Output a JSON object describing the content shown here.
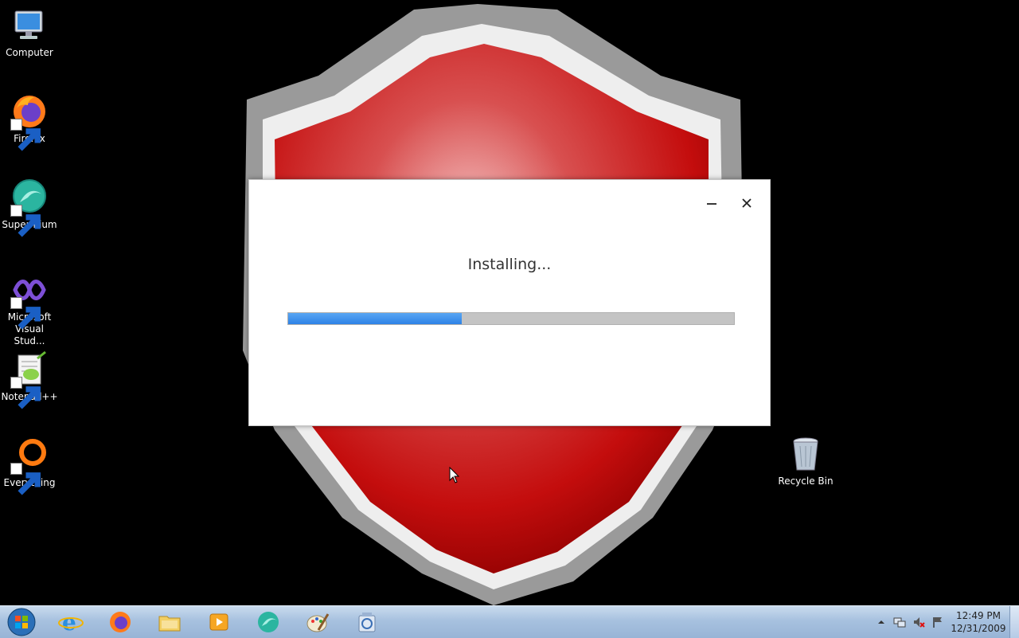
{
  "desktop": {
    "icons": [
      {
        "label": "Computer",
        "icon": "computer-icon"
      },
      {
        "label": "Firefox",
        "icon": "firefox-icon"
      },
      {
        "label": "Supermium",
        "icon": "supermium-icon"
      },
      {
        "label": "Microsoft Visual Stud...",
        "icon": "visual-studio-icon"
      },
      {
        "label": "Notepad++",
        "icon": "notepad-plus-plus-icon"
      },
      {
        "label": "Everything",
        "icon": "everything-icon"
      },
      {
        "label": "Recycle Bin",
        "icon": "recycle-bin-icon"
      }
    ]
  },
  "installer": {
    "status": "Installing...",
    "progress_fraction": 0.39,
    "progress_color": "#3b8ff0"
  },
  "taskbar": {
    "items": [
      {
        "icon": "internet-explorer-icon",
        "active": false
      },
      {
        "icon": "firefox-icon",
        "active": true
      },
      {
        "icon": "file-explorer-icon",
        "active": false
      },
      {
        "icon": "media-player-icon",
        "active": false
      },
      {
        "icon": "supermium-icon",
        "active": false
      },
      {
        "icon": "paint-icon",
        "active": true
      },
      {
        "icon": "installer-icon",
        "active": true
      }
    ],
    "clock": {
      "time": "12:49 PM",
      "date": "12/31/2009"
    }
  },
  "colors": {
    "desktop_background": "#000000",
    "shield_red": "#cc1010",
    "taskbar": "#a7c1df"
  }
}
